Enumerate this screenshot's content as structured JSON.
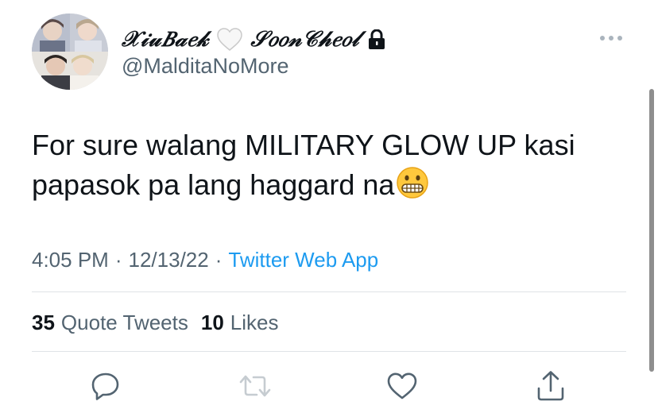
{
  "user": {
    "display_name": "𝒳𝒾𝓊𝐵𝒶𝑒𝓀",
    "display_name_suffix": "𝒮𝑜𝑜𝓃𝒞𝒽𝑒𝑜𝓁",
    "heart_icon": "white-heart-icon",
    "lock_icon": "lock-icon",
    "handle": "@MalditaNoMore"
  },
  "tweet": {
    "text_line_1": "For sure walang MILITARY GLOW UP kasi",
    "text_line_2": "papasok pa lang haggard na",
    "emoji": "grimacing-face-emoji",
    "time": "4:05 PM",
    "separator": "·",
    "date": "12/13/22",
    "source": "Twitter Web App"
  },
  "stats": {
    "quote_tweets_count": "35",
    "quote_tweets_label": "Quote Tweets",
    "likes_count": "10",
    "likes_label": "Likes"
  },
  "actions": [
    "reply-icon",
    "retweet-icon",
    "like-icon",
    "share-icon"
  ],
  "colors": {
    "text": "#0f1419",
    "secondary": "#536471",
    "link": "#1d9bf0",
    "divider": "#dfe3e7"
  }
}
